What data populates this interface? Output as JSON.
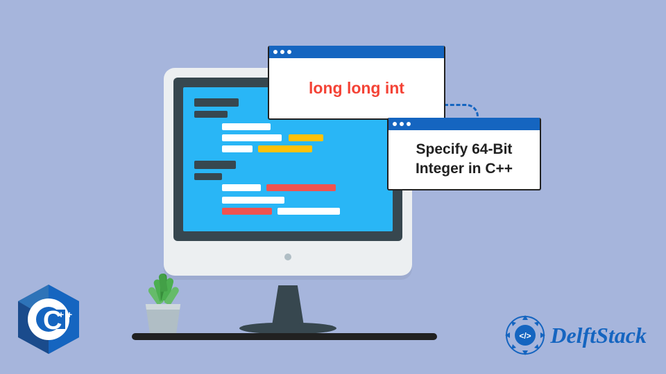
{
  "card1": {
    "text": "long long int"
  },
  "card2": {
    "text": "Specify 64-Bit Integer in C++"
  },
  "cpp_logo": {
    "label": "C++"
  },
  "delft": {
    "brand": "DelftStack",
    "tag": "</>"
  },
  "colors": {
    "bg": "#A6B5DC",
    "accent": "#1565C0",
    "highlight": "#F44336"
  }
}
